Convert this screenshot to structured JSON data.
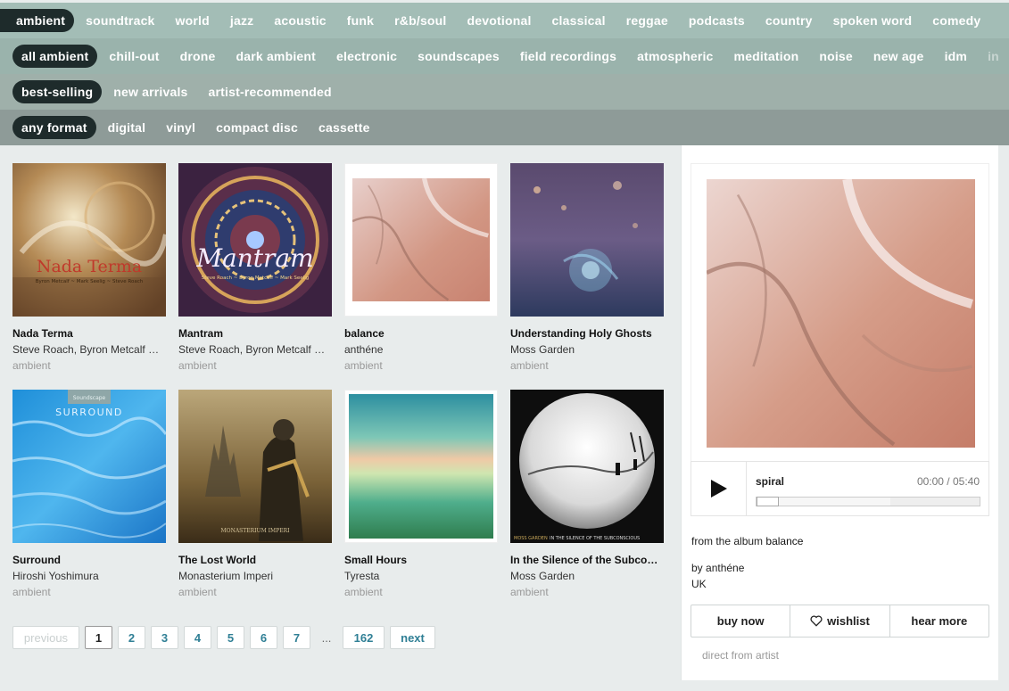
{
  "genres": [
    "ambient",
    "soundtrack",
    "world",
    "jazz",
    "acoustic",
    "funk",
    "r&b/soul",
    "devotional",
    "classical",
    "reggae",
    "podcasts",
    "country",
    "spoken word",
    "comedy"
  ],
  "subgenres": [
    "all ambient",
    "chill-out",
    "drone",
    "dark ambient",
    "electronic",
    "soundscapes",
    "field recordings",
    "atmospheric",
    "meditation",
    "noise",
    "new age",
    "idm",
    "in"
  ],
  "sorts": [
    "best-selling",
    "new arrivals",
    "artist-recommended"
  ],
  "formats": [
    "any format",
    "digital",
    "vinyl",
    "compact disc",
    "cassette"
  ],
  "albums": [
    {
      "title": "Nada Terma",
      "artist": "Steve Roach, Byron Metcalf & Mark Seelig",
      "genre": "ambient",
      "art_text": "Nada Terma",
      "art_sub": "Byron Metcalf ~ Mark Seelig ~ Steve Roach"
    },
    {
      "title": "Mantram",
      "artist": "Steve Roach, Byron Metcalf & Mark Seelig",
      "genre": "ambient",
      "art_text": "Mantram",
      "art_sub": "Steve Roach ~ Byron Metcalf ~ Mark Seelig"
    },
    {
      "title": "balance",
      "artist": "anthéne",
      "genre": "ambient"
    },
    {
      "title": "Understanding Holy Ghosts",
      "artist": "Moss Garden",
      "genre": "ambient"
    },
    {
      "title": "Surround",
      "artist": "Hiroshi Yoshimura",
      "genre": "ambient",
      "art_text": "SURROUND",
      "art_sub": "Soundscape"
    },
    {
      "title": "The Lost World",
      "artist": "Monasterium Imperi",
      "genre": "ambient",
      "art_text": "MONASTERIUM IMPERI"
    },
    {
      "title": "Small Hours",
      "artist": "Tyresta",
      "genre": "ambient"
    },
    {
      "title": "In the Silence of the Subconscious",
      "artist": "Moss Garden",
      "genre": "ambient",
      "art_text": "MOSS GARDEN",
      "art_sub": "IN THE SILENCE OF THE SUBCONSCIOUS"
    }
  ],
  "pagination": {
    "previous": "previous",
    "pages": [
      "1",
      "2",
      "3",
      "4",
      "5",
      "6",
      "7"
    ],
    "current": "1",
    "ellipsis": "...",
    "last": "162",
    "next": "next"
  },
  "player": {
    "track": "spiral",
    "time": "00:00 / 05:40",
    "progress": 0,
    "buffered": 0.6,
    "from_label": "from the album",
    "album": "balance",
    "by_label": "by",
    "artist": "anthéne",
    "location": "UK",
    "buy_label": "buy now",
    "wishlist_label": "wishlist",
    "hear_more_label": "hear more",
    "direct_label": "direct from artist"
  }
}
